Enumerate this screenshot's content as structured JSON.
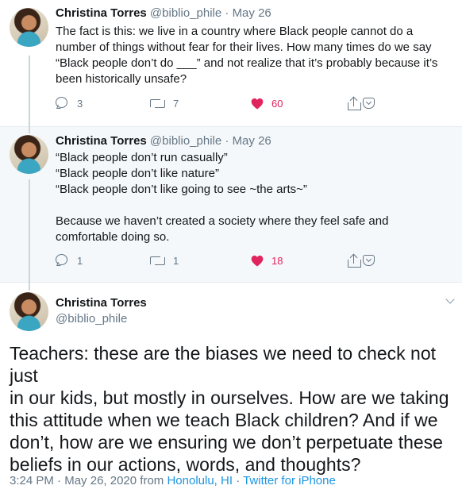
{
  "thread": [
    {
      "author": {
        "name": "Christina Torres",
        "handle": "@biblio_phile"
      },
      "separator": "·",
      "date": "May 26",
      "text_lines": [
        "The fact is this: we live in a country where Black people cannot do a",
        "number of things without fear for their lives. How many times do we say",
        "“Black people don’t do ___” and not realize that it’s probably because it’s",
        "been historically unsafe?"
      ],
      "actions": {
        "replies": "3",
        "retweets": "7",
        "likes": "60"
      }
    },
    {
      "author": {
        "name": "Christina Torres",
        "handle": "@biblio_phile"
      },
      "separator": "·",
      "date": "May 26",
      "text_lines": [
        "“Black people don’t run casually”",
        "“Black people don’t like nature”",
        "“Black people don’t like going to see ~the arts~”",
        "",
        "Because we haven’t created a society where they feel safe and",
        "comfortable doing so."
      ],
      "actions": {
        "replies": "1",
        "retweets": "1",
        "likes": "18"
      }
    }
  ],
  "focal": {
    "author": {
      "name": "Christina Torres",
      "handle": "@biblio_phile"
    },
    "text_lines": [
      "Teachers: these are the biases we need to check not just",
      "in our kids, but mostly in ourselves. How are we taking",
      "this attitude when we teach Black children? And if we",
      "don’t, how are we ensuring we don’t perpetuate these",
      "beliefs in our actions, words, and thoughts?"
    ],
    "meta": {
      "time": "3:24 PM",
      "separator": "·",
      "date": "May 26, 2020",
      "from_label": "from",
      "location": "Honolulu, HI",
      "source": "Twitter for iPhone"
    }
  },
  "colors": {
    "like_red": "#e0245e",
    "link_blue": "#1b95e0",
    "muted_gray": "#657786",
    "thread_line": "#ccd6dd",
    "highlight_bg": "#f5f8fa"
  },
  "icons": [
    "reply-icon",
    "retweet-icon",
    "heart-icon",
    "share-icon",
    "pocket-icon",
    "chevron-down-icon"
  ]
}
